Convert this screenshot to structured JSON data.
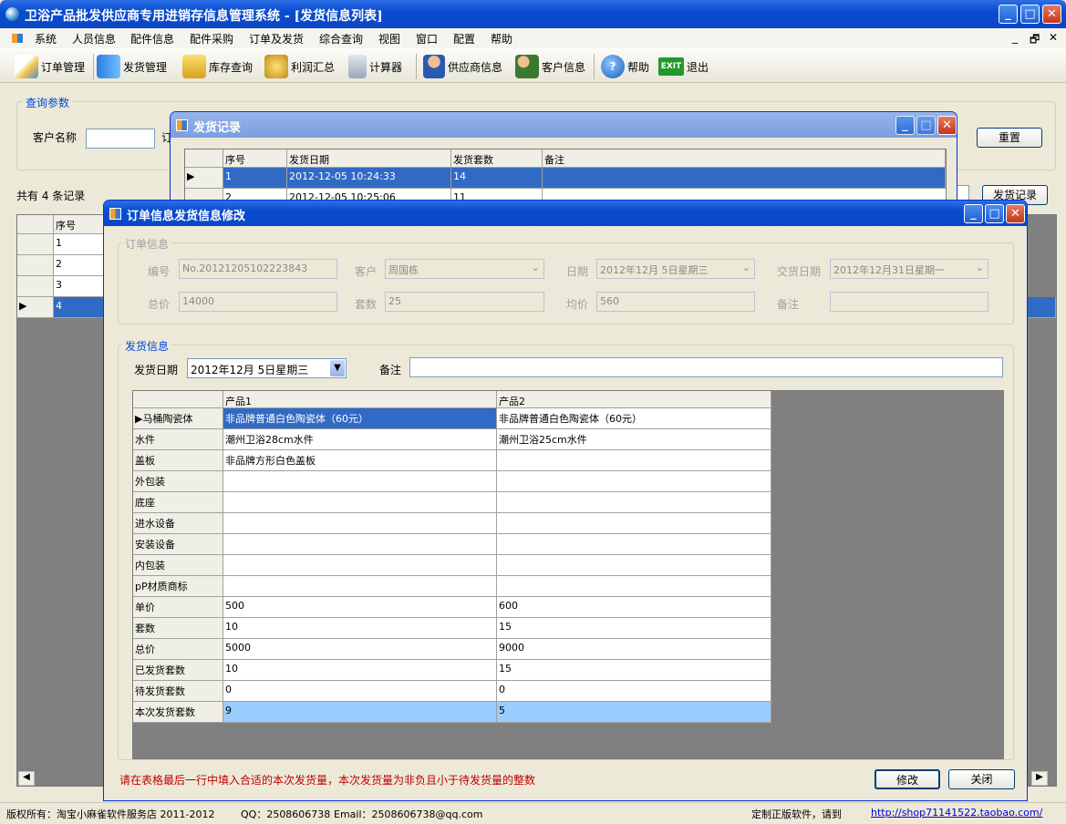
{
  "window": {
    "title": "卫浴产品批发供应商专用进销存信息管理系统 - [发货信息列表]"
  },
  "menu": [
    "系统",
    "人员信息",
    "配件信息",
    "配件采购",
    "订单及发货",
    "综合查询",
    "视图",
    "窗口",
    "配置",
    "帮助"
  ],
  "mdi_controls": [
    "_",
    "🗗",
    "✕"
  ],
  "toolbar": [
    {
      "label": "订单管理",
      "icon": "order-icon"
    },
    {
      "label": "发货管理",
      "icon": "shipping-icon"
    },
    {
      "label": "库存查询",
      "icon": "inventory-icon"
    },
    {
      "label": "利润汇总",
      "icon": "coins-icon"
    },
    {
      "label": "计算器",
      "icon": "calculator-icon"
    },
    {
      "label": "供应商信息",
      "icon": "supplier-icon"
    },
    {
      "label": "客户信息",
      "icon": "customer-icon"
    },
    {
      "label": "帮助",
      "icon": "help-icon"
    },
    {
      "label": "退出",
      "icon": "exit-icon"
    }
  ],
  "exit_badge": "EXIT",
  "query": {
    "legend": "查询参数",
    "customer_label": "客户名称",
    "trunc_label": "订",
    "reset": "重置",
    "count_text": "共有 4 条记录",
    "ship_record_btn": "发货记录"
  },
  "main_grid": {
    "header": "序号",
    "rows": [
      "1",
      "2",
      "3",
      "4"
    ]
  },
  "ship_dialog": {
    "title": "发货记录",
    "columns": [
      "序号",
      "发货日期",
      "发货套数",
      "备注"
    ],
    "rows": [
      [
        "1",
        "2012-12-05 10:24:33",
        "14",
        ""
      ],
      [
        "2",
        "2012-12-05 10:25:06",
        "11",
        ""
      ]
    ]
  },
  "edit_dialog": {
    "title": "订单信息发货信息修改",
    "order_legend": "订单信息",
    "labels": {
      "no": "编号",
      "customer": "客户",
      "date": "日期",
      "delivery": "交货日期",
      "total": "总价",
      "sets": "套数",
      "avg": "均价",
      "remark": "备注"
    },
    "values": {
      "no": "No.20121205102223843",
      "customer": "周国栋",
      "date": "2012年12月 5日星期三",
      "delivery": "2012年12月31日星期一",
      "total": "14000",
      "sets": "25",
      "avg": "560",
      "remark": ""
    },
    "ship_legend": "发货信息",
    "ship_date_label": "发货日期",
    "ship_date": "2012年12月 5日星期三",
    "ship_remark_label": "备注",
    "grid_columns": [
      "产品1",
      "产品2"
    ],
    "grid_rows": [
      {
        "label": "马桶陶瓷体",
        "c1": "非品牌普通白色陶瓷体（60元）",
        "c2": "非品牌普通白色陶瓷体（60元）"
      },
      {
        "label": "水件",
        "c1": "潮州卫浴28cm水件",
        "c2": "潮州卫浴25cm水件"
      },
      {
        "label": "盖板",
        "c1": "非品牌方形白色盖板",
        "c2": ""
      },
      {
        "label": "外包装",
        "c1": "",
        "c2": ""
      },
      {
        "label": "底座",
        "c1": "",
        "c2": ""
      },
      {
        "label": "进水设备",
        "c1": "",
        "c2": ""
      },
      {
        "label": "安装设备",
        "c1": "",
        "c2": ""
      },
      {
        "label": "内包装",
        "c1": "",
        "c2": ""
      },
      {
        "label": "pP材质商标",
        "c1": "",
        "c2": ""
      },
      {
        "label": "单价",
        "c1": "500",
        "c2": "600"
      },
      {
        "label": "套数",
        "c1": "10",
        "c2": "15"
      },
      {
        "label": "总价",
        "c1": "5000",
        "c2": "9000"
      },
      {
        "label": "已发货套数",
        "c1": "10",
        "c2": "15"
      },
      {
        "label": "待发货套数",
        "c1": "0",
        "c2": "0"
      },
      {
        "label": "本次发货套数",
        "c1": "9",
        "c2": "5"
      }
    ],
    "hint": "请在表格最后一行中填入合适的本次发货量，本次发货量为非负且小于待发货量的整数",
    "modify": "修改",
    "close": "关闭"
  },
  "statusbar": {
    "copyright": "版权所有：淘宝小麻雀软件服务店 2011-2012",
    "qq": "QQ：2508606738",
    "email": "Email：2508606738@qq.com",
    "custom": "定制正版软件，请到",
    "link": "http://shop71141522.taobao.com/"
  },
  "colors": {
    "titlebar": "#0a4ccf",
    "selection": "#316ac5",
    "highlight_row": "#99ccff",
    "hint": "#c00000"
  }
}
